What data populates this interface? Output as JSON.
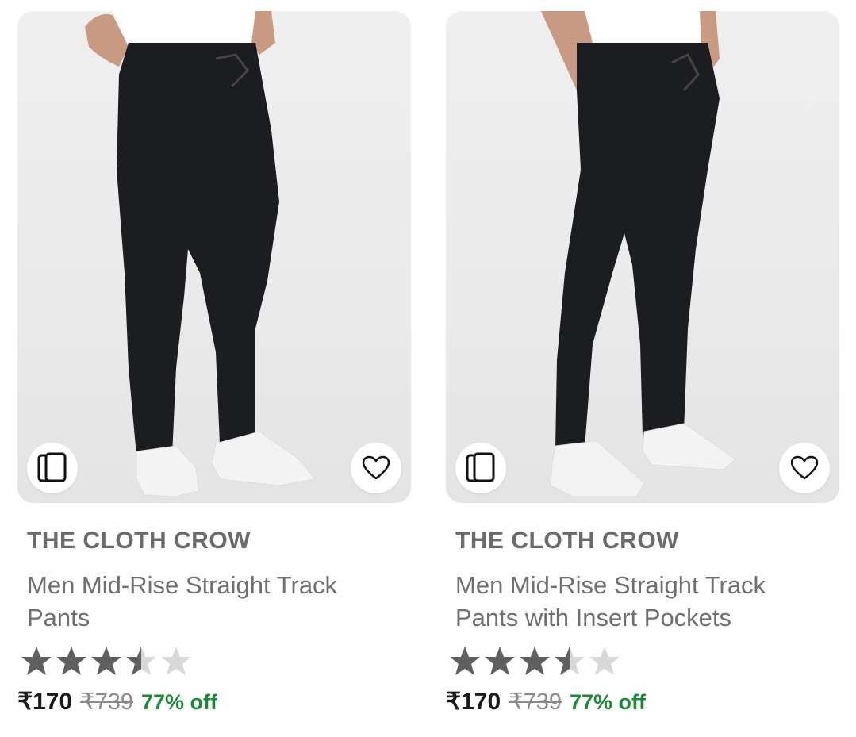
{
  "products": [
    {
      "brand": "THE CLOTH CROW",
      "title": "Men Mid-Rise Straight Track Pants",
      "rating": 3.5,
      "price": "₹170",
      "mrp": "₹739",
      "discount": "77% off"
    },
    {
      "brand": "THE CLOTH CROW",
      "title": "Men Mid-Rise Straight Track Pants with Insert Pockets",
      "rating": 3.5,
      "price": "₹170",
      "mrp": "₹739",
      "discount": "77% off"
    }
  ],
  "icons": {
    "similar": "similar-products-icon",
    "wishlist": "heart-icon",
    "star": "star-icon"
  },
  "colors": {
    "star_filled": "#5f5f5f",
    "star_empty": "#d8d8d8",
    "discount": "#1b8a35",
    "brand": "#6b6b6b"
  }
}
